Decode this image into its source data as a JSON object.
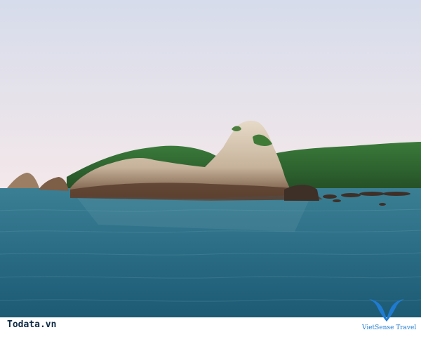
{
  "photo": {
    "subject": "rocky-island-sea-scene",
    "colors": {
      "sky_top": "#dfe4ef",
      "sky_bottom": "#f2e7ea",
      "sea_far": "#2b6f86",
      "sea_near": "#1f5f78",
      "hill_green": "#2f6b2f",
      "rock_light": "#d9cbb8",
      "rock_dark": "#6a4a35"
    }
  },
  "watermark": {
    "site": "Todata.vn",
    "brand": "VietSense Travel",
    "brand_color": "#1f7bd1"
  }
}
